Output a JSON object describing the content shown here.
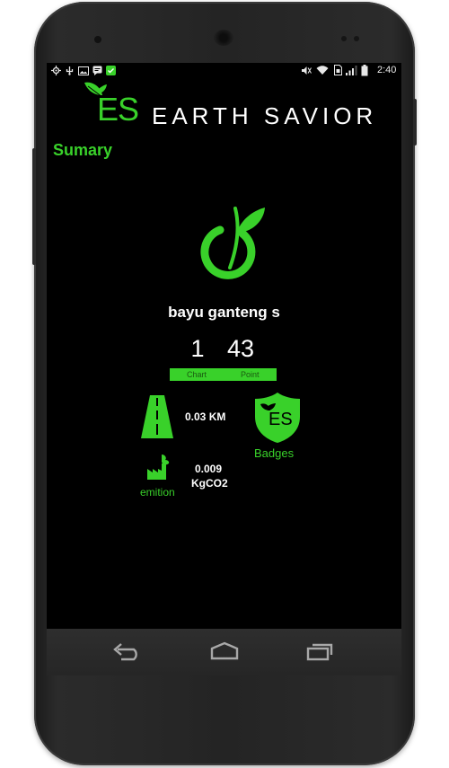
{
  "status_bar": {
    "time": "2:40",
    "left_icons": [
      "gps-icon",
      "usb-icon",
      "image-icon",
      "chat-icon",
      "notification-icon"
    ],
    "right_icons": [
      "mute-icon",
      "wifi-icon",
      "sim-icon",
      "signal-icon",
      "battery-icon"
    ]
  },
  "header": {
    "logo_text": "ES",
    "app_name": "EARTH SAVIOR"
  },
  "page_title": "Sumary",
  "profile": {
    "username": "bayu ganteng s",
    "chart_value": "1",
    "chart_label": "Chart",
    "point_value": "43",
    "point_label": "Point"
  },
  "stats": {
    "distance": "0.03 KM",
    "emission_value": "0.009",
    "emission_unit": "KgCO2",
    "emission_label": "emition",
    "badge_logo_text": "ES",
    "badges_label": "Badges"
  },
  "nav": {
    "icons": [
      "back-icon",
      "home-icon",
      "recents-icon"
    ]
  },
  "colors": {
    "accent": "#39d12a",
    "background": "#000000"
  }
}
